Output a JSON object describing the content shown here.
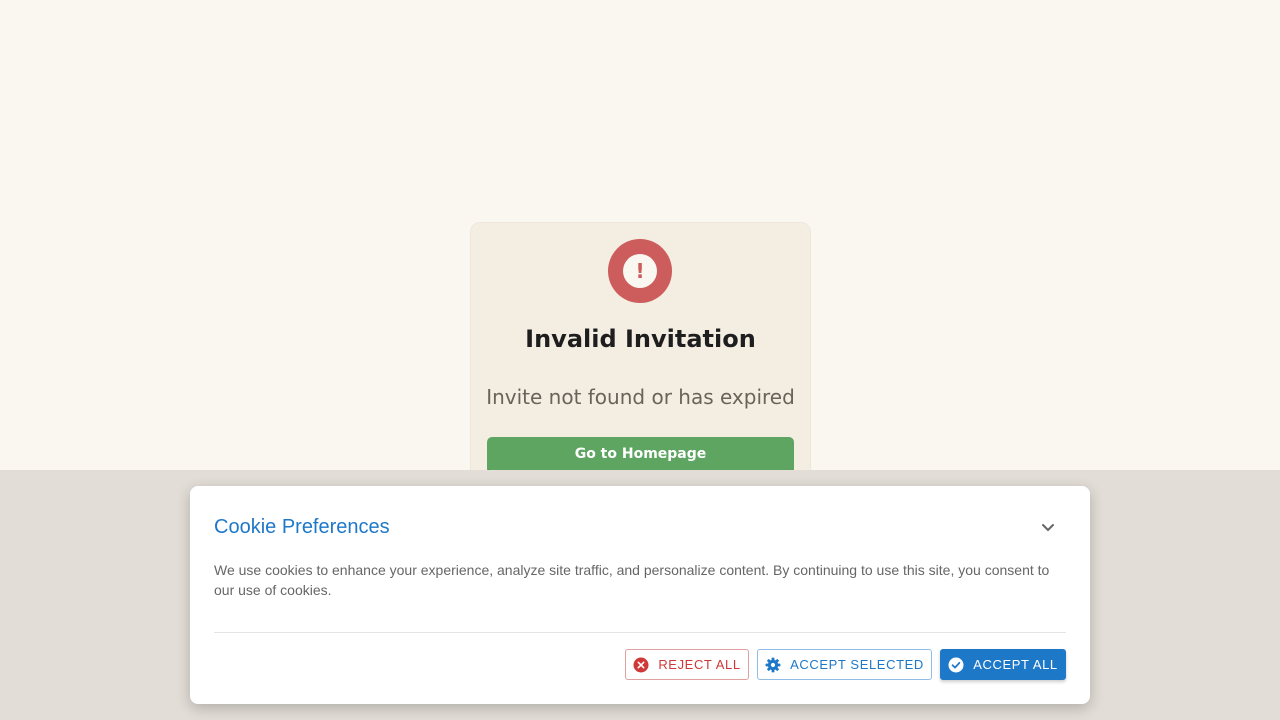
{
  "invite": {
    "icon": "exclamation-circle-icon",
    "icon_glyph": "!",
    "title": "Invalid Invitation",
    "message": "Invite not found or has expired",
    "button_label": "Go to Homepage"
  },
  "cookie": {
    "title": "Cookie Preferences",
    "description": "We use cookies to enhance your experience, analyze site traffic, and personalize content. By continuing to use this site, you consent to our use of cookies.",
    "buttons": {
      "reject_label": "REJECT ALL",
      "accept_selected_label": "ACCEPT SELECTED",
      "accept_all_label": "ACCEPT ALL"
    }
  },
  "colors": {
    "page_background": "#faf6f0",
    "card_background": "#f4ede2",
    "error_red": "#cd5c5c",
    "primary_green": "#5ea562",
    "cookie_blue": "#1e78c8",
    "reject_red": "#d03838"
  }
}
